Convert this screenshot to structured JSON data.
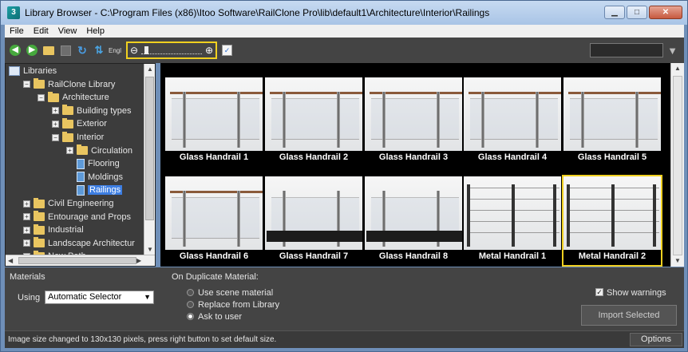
{
  "window": {
    "title": "Library Browser - C:\\Program Files (x86)\\Itoo Software\\RailClone Pro\\lib\\default1\\Architecture\\Interior\\Railings",
    "minimize": "▁",
    "maximize": "□",
    "close": "✕"
  },
  "menu": [
    "File",
    "Edit",
    "View",
    "Help"
  ],
  "toolbar": {
    "lang_label": "Engl",
    "icons": [
      "back-icon",
      "forward-icon",
      "open-folder-icon",
      "save-icon",
      "refresh-icon",
      "sort-icon",
      "zoom-out-icon",
      "zoom-in-icon",
      "checklist-icon",
      "filter-icon"
    ],
    "search_value": ""
  },
  "tree": {
    "items": [
      {
        "label": "Libraries",
        "indent": 0,
        "type": "root"
      },
      {
        "label": "RailClone Library",
        "indent": 1,
        "type": "folder",
        "expanded": true
      },
      {
        "label": "Architecture",
        "indent": 2,
        "type": "folder",
        "expanded": true
      },
      {
        "label": "Building types",
        "indent": 3,
        "type": "folder",
        "expanded": false
      },
      {
        "label": "Exterior",
        "indent": 3,
        "type": "folder",
        "expanded": false
      },
      {
        "label": "Interior",
        "indent": 3,
        "type": "folder",
        "expanded": true
      },
      {
        "label": "Circulation",
        "indent": 4,
        "type": "folder",
        "expanded": false
      },
      {
        "label": "Flooring",
        "indent": 4,
        "type": "doc"
      },
      {
        "label": "Moldings",
        "indent": 4,
        "type": "doc"
      },
      {
        "label": "Railings",
        "indent": 4,
        "type": "doc",
        "selected": true
      },
      {
        "label": "Civil Engineering",
        "indent": 1,
        "type": "folder",
        "expanded": false
      },
      {
        "label": "Entourage and Props",
        "indent": 1,
        "type": "folder",
        "expanded": false
      },
      {
        "label": "Industrial",
        "indent": 1,
        "type": "folder",
        "expanded": false
      },
      {
        "label": "Landscape Architectur",
        "indent": 1,
        "type": "folder",
        "expanded": false
      },
      {
        "label": "New Path",
        "indent": 1,
        "type": "folder",
        "expanded": false
      }
    ]
  },
  "grid": {
    "items": [
      {
        "label": "Glass Handrail 1",
        "style": "glass"
      },
      {
        "label": "Glass Handrail 2",
        "style": "glass"
      },
      {
        "label": "Glass Handrail 3",
        "style": "glass"
      },
      {
        "label": "Glass Handrail 4",
        "style": "glass"
      },
      {
        "label": "Glass Handrail 5",
        "style": "glass"
      },
      {
        "label": "Glass Handrail 6",
        "style": "glass"
      },
      {
        "label": "Glass Handrail 7",
        "style": "glass-base"
      },
      {
        "label": "Glass Handrail 8",
        "style": "glass-base"
      },
      {
        "label": "Metal Handrail 1",
        "style": "metal"
      },
      {
        "label": "Metal Handrail 2",
        "style": "metal",
        "selected": true
      }
    ]
  },
  "materials": {
    "heading": "Materials",
    "using_label": "Using",
    "selector_value": "Automatic Selector",
    "dup_heading": "On Duplicate Material:",
    "options": [
      {
        "label": "Use scene material",
        "checked": false
      },
      {
        "label": "Replace from Library",
        "checked": false
      },
      {
        "label": "Ask to user",
        "checked": true
      }
    ],
    "show_warnings_label": "Show warnings",
    "show_warnings_checked": true,
    "import_label": "Import Selected"
  },
  "status": {
    "text": "Image size changed to 130x130 pixels, press right button to set default size.",
    "options_label": "Options"
  },
  "colors": {
    "accent": "#f0d020",
    "selection": "#3d7ee2",
    "panel": "#444444"
  }
}
